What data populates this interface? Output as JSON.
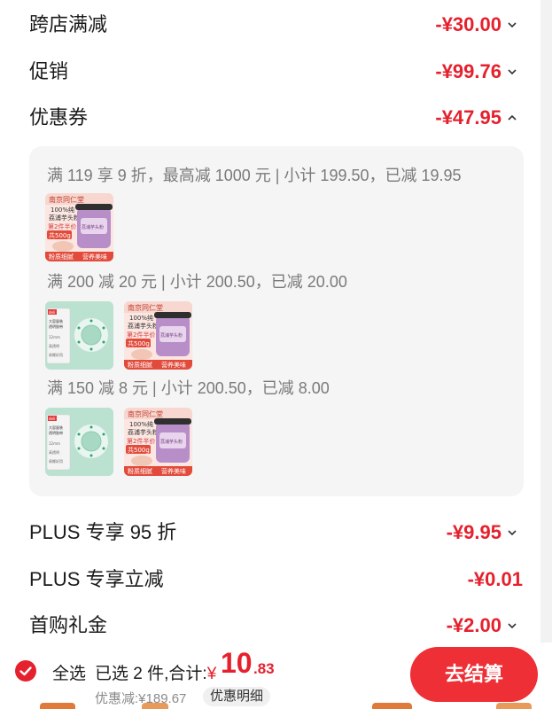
{
  "rows_top": [
    {
      "name": "row-cross-store-discount",
      "label": "跨店满减",
      "amount": "-¥30.00",
      "chevron": "down"
    },
    {
      "name": "row-promotion",
      "label": "促销",
      "amount": "-¥99.76",
      "chevron": "down"
    },
    {
      "name": "row-coupons",
      "label": "优惠券",
      "amount": "-¥47.95",
      "chevron": "up"
    }
  ],
  "coupons": {
    "lines": [
      "满 119 享 9 折，最高减 1000 元 | 小计 199.50，已减 19.95",
      "满 200 减 20 元 | 小计 200.50，已减 20.00",
      "满 150 减 8 元 | 小计 200.50，已减 8.00"
    ],
    "product_a": {
      "brand": "南京同仁堂",
      "line1": "100%纯",
      "line2": "荔浦芋头粉",
      "line3": "第2件半价",
      "weight": "共500g",
      "tag1": "粉质细腻",
      "tag2": "营养美味",
      "jar": "荔浦芋头粉"
    },
    "product_b": {
      "brand": "deli",
      "box1": "大容量装",
      "box2": "透明胶带",
      "box3": "12mm",
      "box4": "高透明",
      "box5": "易撕好用"
    }
  },
  "rows_bottom": [
    {
      "name": "row-plus-95",
      "label": "PLUS 专享 95 折",
      "amount": "-¥9.95",
      "chevron": "down"
    },
    {
      "name": "row-plus-instant",
      "label": "PLUS 专享立减",
      "amount": "-¥0.01",
      "chevron": "none"
    },
    {
      "name": "row-first-order",
      "label": "首购礼金",
      "amount": "-¥2.00",
      "chevron": "down"
    }
  ],
  "footer": {
    "select_all": "全选",
    "selected_prefix": "已选 2 件,合计:",
    "currency": "¥",
    "total_int": "10",
    "total_dec": ".83",
    "discount_text": "优惠减:¥189.67",
    "detail_label": "优惠明细",
    "checkout_label": "去结算"
  },
  "colors": {
    "accent_red": "#e5212e",
    "checkout_red": "#ee2f35",
    "coupon_bg": "#f5f5f5",
    "muted_text": "#7a7a7a"
  }
}
